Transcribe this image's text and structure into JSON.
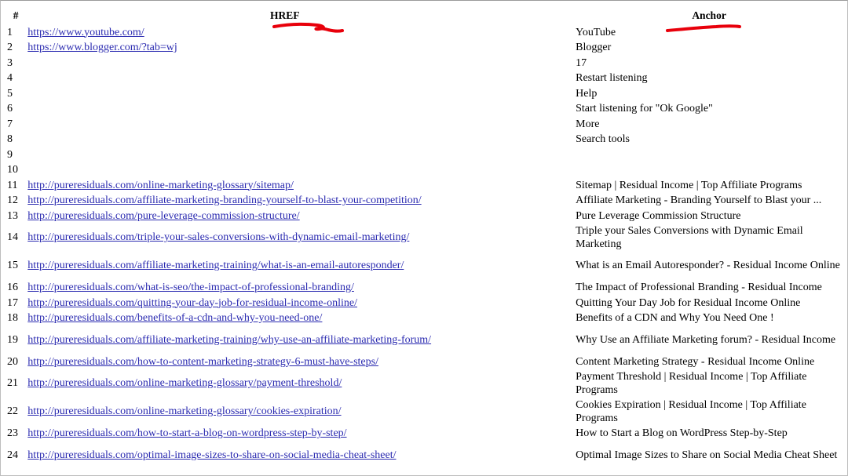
{
  "table": {
    "headers": {
      "num": "#",
      "href": "HREF",
      "anchor": "Anchor"
    },
    "rows": [
      {
        "num": "1",
        "href": "https://www.youtube.com/",
        "anchor": "YouTube"
      },
      {
        "num": "2",
        "href": "https://www.blogger.com/?tab=wj",
        "anchor": "Blogger"
      },
      {
        "num": "3",
        "href": "",
        "anchor": "17"
      },
      {
        "num": "4",
        "href": "",
        "anchor": "Restart listening"
      },
      {
        "num": "5",
        "href": "",
        "anchor": "Help"
      },
      {
        "num": "6",
        "href": "",
        "anchor": "Start listening for \"Ok Google\""
      },
      {
        "num": "7",
        "href": "",
        "anchor": "More"
      },
      {
        "num": "8",
        "href": "",
        "anchor": "Search tools"
      },
      {
        "num": "9",
        "href": "",
        "anchor": ""
      },
      {
        "num": "10",
        "href": "",
        "anchor": ""
      },
      {
        "num": "11",
        "href": "http://pureresiduals.com/online-marketing-glossary/sitemap/",
        "anchor": "Sitemap | Residual Income | Top Affiliate Programs"
      },
      {
        "num": "12",
        "href": "http://pureresiduals.com/affiliate-marketing-branding-yourself-to-blast-your-competition/",
        "anchor": "Affiliate Marketing - Branding Yourself to Blast your ..."
      },
      {
        "num": "13",
        "href": "http://pureresiduals.com/pure-leverage-commission-structure/",
        "anchor": "Pure Leverage Commission Structure"
      },
      {
        "num": "14",
        "href": "http://pureresiduals.com/triple-your-sales-conversions-with-dynamic-email-marketing/",
        "anchor": "Triple your Sales Conversions with Dynamic Email Marketing"
      },
      {
        "num": "15",
        "href": "http://pureresiduals.com/affiliate-marketing-training/what-is-an-email-autoresponder/",
        "anchor": "What is an Email Autoresponder? - Residual Income Online"
      },
      {
        "num": "16",
        "href": "http://pureresiduals.com/what-is-seo/the-impact-of-professional-branding/",
        "anchor": "The Impact of Professional Branding - Residual Income"
      },
      {
        "num": "17",
        "href": "http://pureresiduals.com/quitting-your-day-job-for-residual-income-online/",
        "anchor": "Quitting Your Day Job for Residual Income Online"
      },
      {
        "num": "18",
        "href": "http://pureresiduals.com/benefits-of-a-cdn-and-why-you-need-one/",
        "anchor": "Benefits of a CDN and Why You Need One !"
      },
      {
        "num": "19",
        "href": "http://pureresiduals.com/affiliate-marketing-training/why-use-an-affiliate-marketing-forum/",
        "anchor": "Why Use an Affiliate Marketing forum? - Residual Income"
      },
      {
        "num": "20",
        "href": "http://pureresiduals.com/how-to-content-marketing-strategy-6-must-have-steps/",
        "anchor": "Content Marketing Strategy - Residual Income Online"
      },
      {
        "num": "21",
        "href": "http://pureresiduals.com/online-marketing-glossary/payment-threshold/",
        "anchor": "Payment Threshold | Residual Income | Top Affiliate Programs"
      },
      {
        "num": "22",
        "href": "http://pureresiduals.com/online-marketing-glossary/cookies-expiration/",
        "anchor": "Cookies Expiration | Residual Income | Top Affiliate Programs"
      },
      {
        "num": "23",
        "href": "http://pureresiduals.com/how-to-start-a-blog-on-wordpress-step-by-step/",
        "anchor": "How to Start a Blog on WordPress Step-by-Step"
      },
      {
        "num": "24",
        "href": "http://pureresiduals.com/optimal-image-sizes-to-share-on-social-media-cheat-sheet/",
        "anchor": "Optimal Image Sizes to Share on Social Media Cheat Sheet"
      }
    ]
  },
  "annotations": {
    "marker_color": "#e8000b"
  }
}
